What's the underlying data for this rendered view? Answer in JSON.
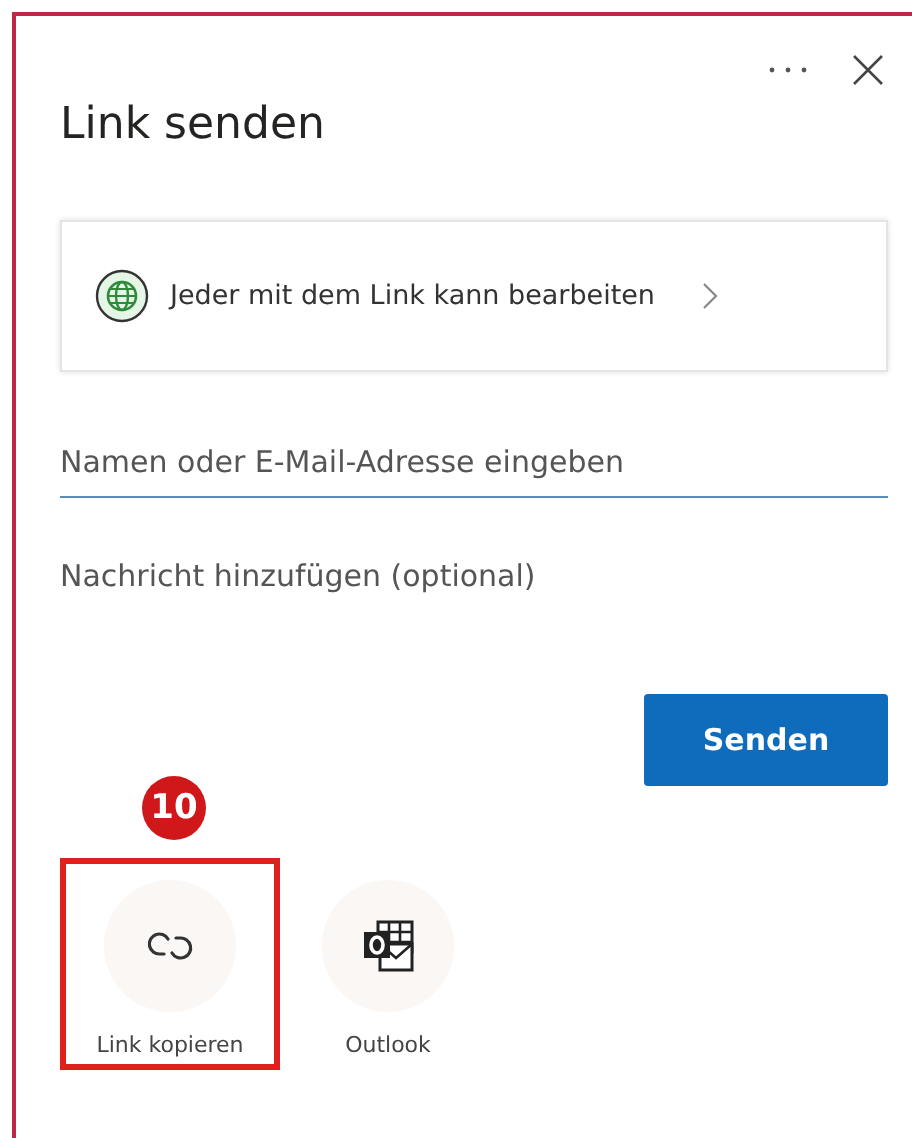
{
  "title": "Link senden",
  "permission": {
    "text": "Jeder mit dem Link kann bearbeiten"
  },
  "recipient": {
    "placeholder": "Namen oder E-Mail-Adresse eingeben"
  },
  "message": {
    "placeholder": "Nachricht hinzufügen (optional)"
  },
  "send_button": "Senden",
  "share_options": [
    {
      "kind": "link",
      "label": "Link kopieren",
      "highlighted": true,
      "callout": "10"
    },
    {
      "kind": "outlook",
      "label": "Outlook",
      "highlighted": false
    }
  ]
}
